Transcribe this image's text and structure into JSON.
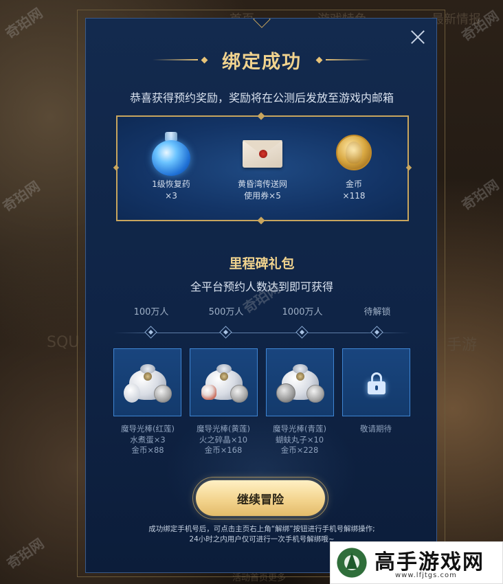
{
  "background": {
    "nav_items": [
      "首页",
      "游戏特色",
      "最新情报"
    ],
    "bottom_text": "活动首页更多",
    "side_text_left": "SQU",
    "side_text_right": "手游"
  },
  "watermarks": [
    "奇珀网",
    "奇珀网",
    "奇珀网",
    "奇珀网",
    "奇珀网",
    "奇珀网"
  ],
  "dialog": {
    "title": "绑定成功",
    "subtitle": "恭喜获得预约奖励，奖励将在公测后发放至游戏内邮箱",
    "rewards": [
      {
        "icon": "potion-icon",
        "name": "1级恢复药",
        "qty": "×3"
      },
      {
        "icon": "envelope-icon",
        "name": "黄昏湾传送网",
        "qty": "使用券×5"
      },
      {
        "icon": "gold-coin-icon",
        "name": "金币",
        "qty": "×118"
      }
    ],
    "milestone": {
      "title": "里程碑礼包",
      "subtitle": "全平台预约人数达到即可获得",
      "tiers": [
        {
          "label": "100万人",
          "lines": [
            "魔导光棒(红莲)",
            "水煮蛋×3",
            "金币×88"
          ],
          "locked": false
        },
        {
          "label": "500万人",
          "lines": [
            "魔导光棒(黄莲)",
            "火之碎晶×10",
            "金币×168"
          ],
          "locked": false
        },
        {
          "label": "1000万人",
          "lines": [
            "魔导光棒(青莲)",
            "蝴蚨丸子×10",
            "金币×228"
          ],
          "locked": false
        },
        {
          "label": "待解锁",
          "lines": [
            "敬请期待"
          ],
          "locked": true
        }
      ]
    },
    "cta_label": "继续冒险",
    "note_lines": [
      "成功绑定手机号后，可点击主页右上角“解绑”按钮进行手机号解绑操作;",
      "24小时之内用户仅可进行一次手机号解绑哦~"
    ]
  },
  "brand": {
    "name": "高手游戏网",
    "url": "www.lfjtgs.com"
  }
}
